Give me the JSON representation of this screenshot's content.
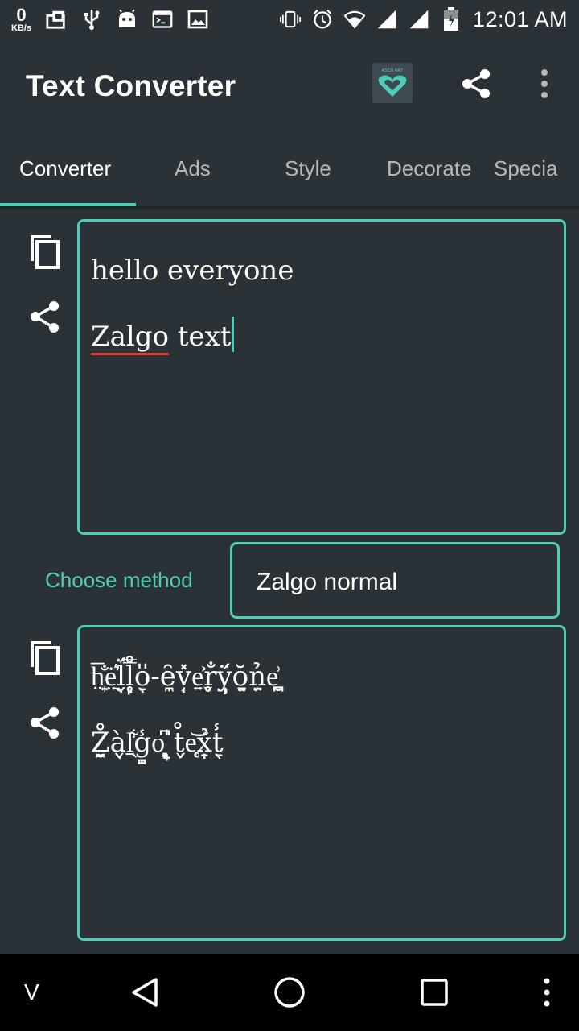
{
  "status_bar": {
    "speed_value": "0",
    "speed_unit": "KB/s",
    "time": "12:01 AM",
    "icons": [
      "usb-icon",
      "android-icon",
      "terminal-icon",
      "image-icon",
      "vibrate-icon",
      "alarm-icon",
      "wifi-icon",
      "signal-icon",
      "battery-icon"
    ]
  },
  "app_bar": {
    "title": "Text Converter",
    "logo_text": "ASCII ART",
    "actions": [
      "share-icon",
      "more-vert-icon"
    ]
  },
  "tabs": [
    {
      "label": "Converter",
      "active": true
    },
    {
      "label": "Ads"
    },
    {
      "label": "Style"
    },
    {
      "label": "Decorate"
    },
    {
      "label": "Specia"
    }
  ],
  "input": {
    "line1": "hello everyone",
    "line2_word": "Zalgo",
    "line2_rest": " text"
  },
  "method": {
    "label": "Choose method",
    "value": "Zalgo normal"
  },
  "output": {
    "line1": "h̤̫͙̅̐e̖̤͛̇l̗̖̈́l̥̙̊̿o̖̞̎-ȇ̼̱v̦̩̽e̤̠͐r̥̬̐ÿ̩̹́ŏ̫̱n̦̤̉e̮̪͗",
    "line2": "Z̼̮̊à̬̖l̠̖͋g̝̪̾o̞̙͆ ̟̩̍t̬̗̊e̜̥͝x̠̩̉t̠̖̾"
  },
  "nav_bar": {
    "left_label": "V"
  },
  "colors": {
    "background": "#2b3237",
    "accent": "#4ecdb9",
    "spellcheck": "#e53935"
  }
}
